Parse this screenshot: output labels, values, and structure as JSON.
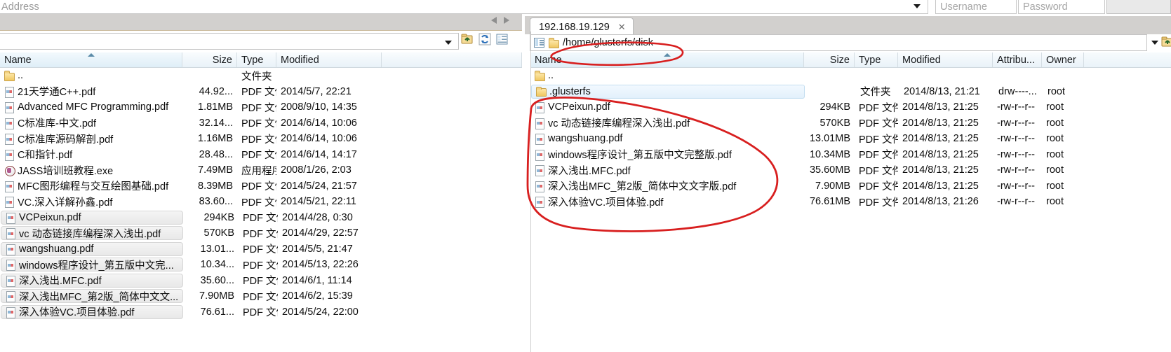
{
  "connection_bar": {
    "address_placeholder": "Address",
    "address_value": "",
    "username_placeholder": "Username",
    "password_placeholder": "Password",
    "dropdown_icon": "chevron-down-icon"
  },
  "left_panel": {
    "path_value": "",
    "path_dropdown_icon": "chevron-down-icon",
    "toolbar": [
      {
        "name": "up-one-level-icon",
        "label": ""
      },
      {
        "name": "refresh-icon",
        "label": ""
      },
      {
        "name": "view-mode-icon",
        "label": ""
      }
    ],
    "columns": [
      "Name",
      "Size",
      "Type",
      "Modified"
    ],
    "sorted_column": "Name",
    "rows": [
      {
        "icon": "folder-icon",
        "name": "..",
        "size": "",
        "type": "文件夹",
        "modified": "",
        "selected": false
      },
      {
        "icon": "pdf-icon",
        "name": "21天学通C++.pdf",
        "size": "44.92...",
        "type": "PDF 文件",
        "modified": "2014/5/7, 22:21",
        "selected": false
      },
      {
        "icon": "pdf-icon",
        "name": "Advanced MFC Programming.pdf",
        "size": "1.81MB",
        "type": "PDF 文件",
        "modified": "2008/9/10, 14:35",
        "selected": false
      },
      {
        "icon": "pdf-icon",
        "name": "C标准库-中文.pdf",
        "size": "32.14...",
        "type": "PDF 文件",
        "modified": "2014/6/14, 10:06",
        "selected": false
      },
      {
        "icon": "pdf-icon",
        "name": "C标准库源码解剖.pdf",
        "size": "1.16MB",
        "type": "PDF 文件",
        "modified": "2014/6/14, 10:06",
        "selected": false
      },
      {
        "icon": "pdf-icon",
        "name": "C和指针.pdf",
        "size": "28.48...",
        "type": "PDF 文件",
        "modified": "2014/6/14, 14:17",
        "selected": false
      },
      {
        "icon": "exe-icon",
        "name": "JASS培训班教程.exe",
        "size": "7.49MB",
        "type": "应用程序",
        "modified": "2008/1/26, 2:03",
        "selected": false
      },
      {
        "icon": "pdf-icon",
        "name": "MFC图形编程与交互绘图基础.pdf",
        "size": "8.39MB",
        "type": "PDF 文件",
        "modified": "2014/5/24, 21:57",
        "selected": false
      },
      {
        "icon": "pdf-icon",
        "name": "VC.深入详解孙鑫.pdf",
        "size": "83.60...",
        "type": "PDF 文件",
        "modified": "2014/5/21, 22:11",
        "selected": false
      },
      {
        "icon": "pdf-icon",
        "name": "VCPeixun.pdf",
        "size": "294KB",
        "type": "PDF 文件",
        "modified": "2014/4/28, 0:30",
        "selected": true
      },
      {
        "icon": "pdf-icon",
        "name": "vc 动态链接库编程深入浅出.pdf",
        "size": "570KB",
        "type": "PDF 文件",
        "modified": "2014/4/29, 22:57",
        "selected": true
      },
      {
        "icon": "pdf-icon",
        "name": "wangshuang.pdf",
        "size": "13.01...",
        "type": "PDF 文件",
        "modified": "2014/5/5, 21:47",
        "selected": true
      },
      {
        "icon": "pdf-icon",
        "name": "windows程序设计_第五版中文完...",
        "size": "10.34...",
        "type": "PDF 文件",
        "modified": "2014/5/13, 22:26",
        "selected": true
      },
      {
        "icon": "pdf-icon",
        "name": "深入浅出.MFC.pdf",
        "size": "35.60...",
        "type": "PDF 文件",
        "modified": "2014/6/1, 11:14",
        "selected": true
      },
      {
        "icon": "pdf-icon",
        "name": "深入浅出MFC_第2版_简体中文文...",
        "size": "7.90MB",
        "type": "PDF 文件",
        "modified": "2014/6/2, 15:39",
        "selected": true
      },
      {
        "icon": "pdf-icon",
        "name": "深入体验VC.项目体验.pdf",
        "size": "76.61...",
        "type": "PDF 文件",
        "modified": "2014/5/24, 22:00",
        "selected": true
      }
    ]
  },
  "right_panel": {
    "tab": {
      "label": "192.168.19.129",
      "close_icon": "close-icon"
    },
    "path_value": "/home/glusterfs/disk",
    "path_list_icon": "tree-view-icon",
    "path_folder_icon": "folder-icon",
    "path_dropdown_icon": "chevron-down-icon",
    "go_icon": "up-one-level-icon",
    "columns": [
      "Name",
      "Size",
      "Type",
      "Modified",
      "Attribu...",
      "Owner"
    ],
    "sorted_column": "Name",
    "rows": [
      {
        "icon": "folder-icon",
        "name": "..",
        "size": "",
        "type": "",
        "modified": "",
        "attributes": "",
        "owner": "",
        "selected": false
      },
      {
        "icon": "folder-icon",
        "name": ".glusterfs",
        "size": "",
        "type": "文件夹",
        "modified": "2014/8/13, 21:21",
        "attributes": "drw----...",
        "owner": "root",
        "selected": true
      },
      {
        "icon": "pdf-icon",
        "name": "VCPeixun.pdf",
        "size": "294KB",
        "type": "PDF 文件",
        "modified": "2014/8/13, 21:25",
        "attributes": "-rw-r--r--",
        "owner": "root",
        "selected": false
      },
      {
        "icon": "pdf-icon",
        "name": "vc 动态链接库编程深入浅出.pdf",
        "size": "570KB",
        "type": "PDF 文件",
        "modified": "2014/8/13, 21:25",
        "attributes": "-rw-r--r--",
        "owner": "root",
        "selected": false
      },
      {
        "icon": "pdf-icon",
        "name": "wangshuang.pdf",
        "size": "13.01MB",
        "type": "PDF 文件",
        "modified": "2014/8/13, 21:25",
        "attributes": "-rw-r--r--",
        "owner": "root",
        "selected": false
      },
      {
        "icon": "pdf-icon",
        "name": "windows程序设计_第五版中文完整版.pdf",
        "size": "10.34MB",
        "type": "PDF 文件",
        "modified": "2014/8/13, 21:25",
        "attributes": "-rw-r--r--",
        "owner": "root",
        "selected": false
      },
      {
        "icon": "pdf-icon",
        "name": "深入浅出.MFC.pdf",
        "size": "35.60MB",
        "type": "PDF 文件",
        "modified": "2014/8/13, 21:25",
        "attributes": "-rw-r--r--",
        "owner": "root",
        "selected": false
      },
      {
        "icon": "pdf-icon",
        "name": "深入浅出MFC_第2版_简体中文文字版.pdf",
        "size": "7.90MB",
        "type": "PDF 文件",
        "modified": "2014/8/13, 21:25",
        "attributes": "-rw-r--r--",
        "owner": "root",
        "selected": false
      },
      {
        "icon": "pdf-icon",
        "name": "深入体验VC.项目体验.pdf",
        "size": "76.61MB",
        "type": "PDF 文件",
        "modified": "2014/8/13, 21:26",
        "attributes": "-rw-r--r--",
        "owner": "root",
        "selected": false
      }
    ]
  },
  "annotations": {
    "color": "#d81f1f",
    "items": [
      {
        "name": "path-ellipse-annotation",
        "target": "/home/glusterfs/disk"
      },
      {
        "name": "file-list-ellipse-annotation",
        "target": "right panel file list"
      }
    ]
  },
  "theme": {
    "chrome_grey": "#d2d0ce",
    "header_blue": "#eaf3f9",
    "selection_grey": "#e8e8e8",
    "selection_blue": "#e2f0fb",
    "annotation_red": "#d81f1f"
  }
}
